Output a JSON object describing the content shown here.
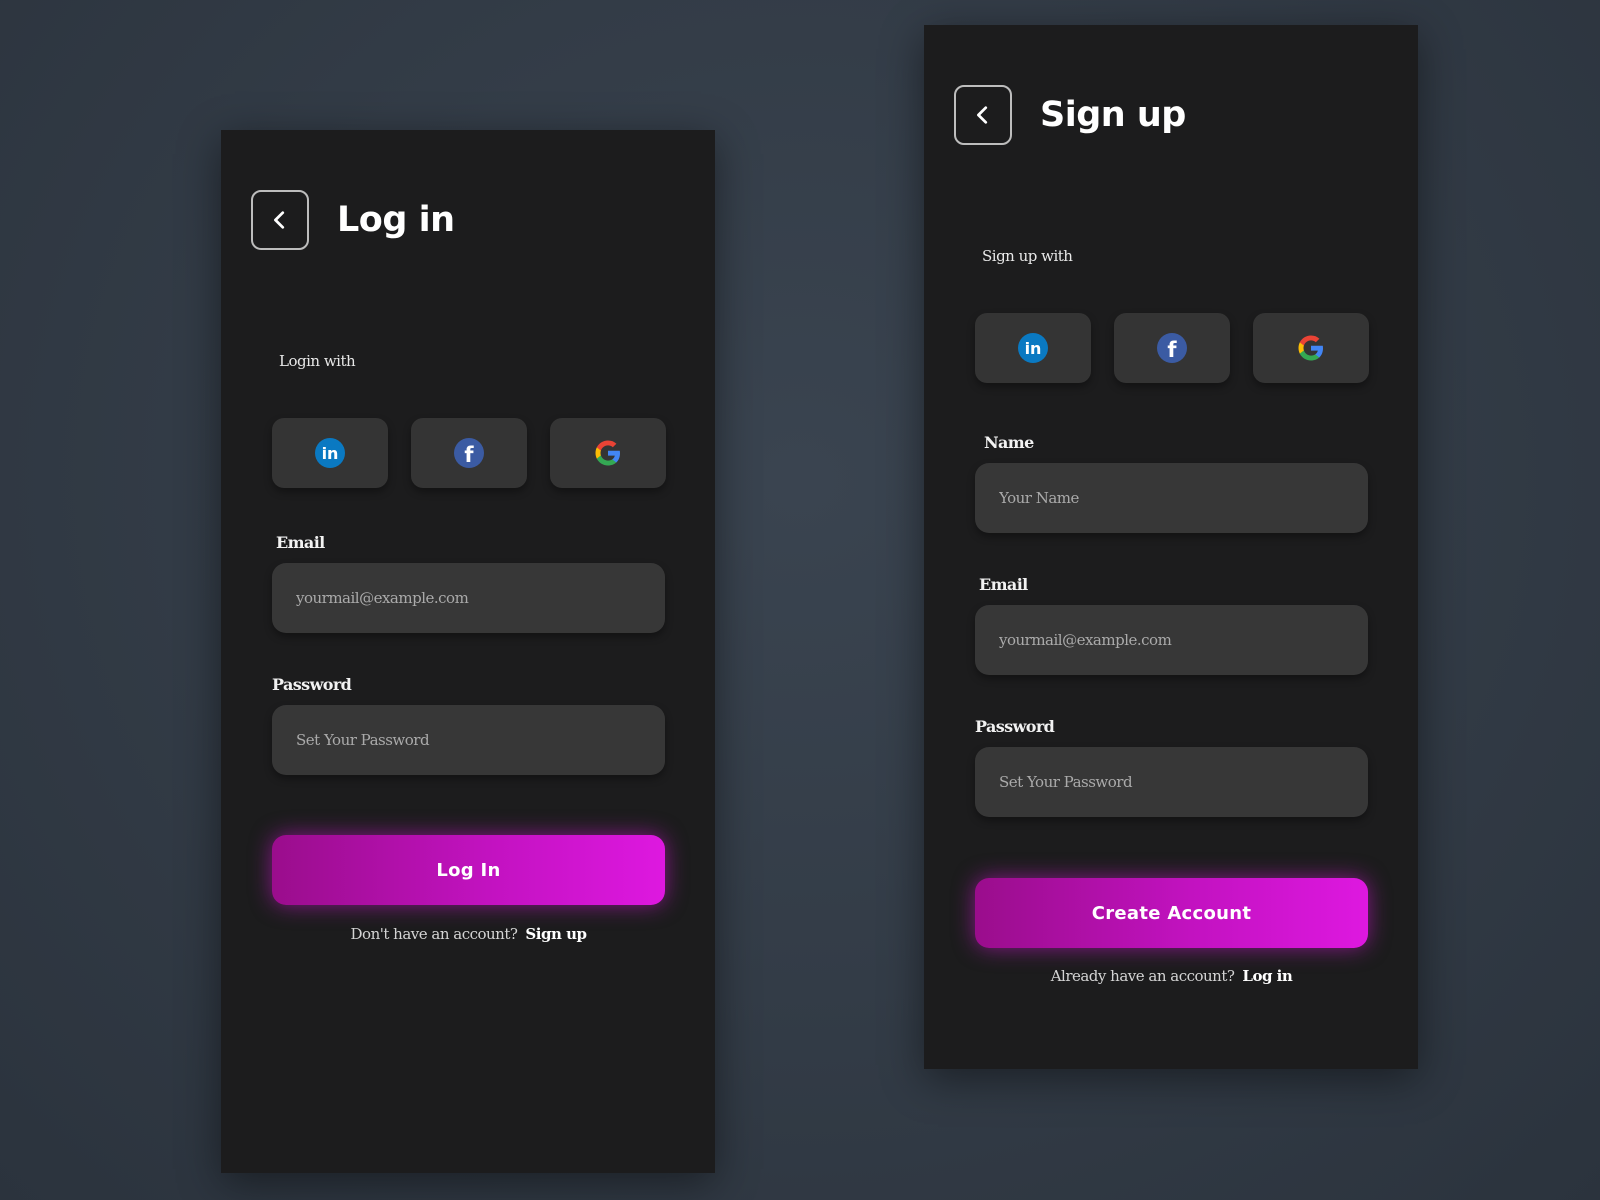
{
  "login": {
    "title": "Log in",
    "social_label": "Login with",
    "social": [
      {
        "name": "LinkedIn",
        "icon": "linkedin-icon"
      },
      {
        "name": "Facebook",
        "icon": "facebook-icon"
      },
      {
        "name": "Google",
        "icon": "google-icon"
      }
    ],
    "email_label": "Email",
    "email_placeholder": "yourmail@example.com",
    "password_label": "Password",
    "password_placeholder": "Set Your Password",
    "submit_label": "Log In",
    "footer_text": "Don't have an account?",
    "footer_link": "Sign up"
  },
  "signup": {
    "title": "Sign up",
    "social_label": "Sign up with",
    "social": [
      {
        "name": "LinkedIn",
        "icon": "linkedin-icon"
      },
      {
        "name": "Facebook",
        "icon": "facebook-icon"
      },
      {
        "name": "Google",
        "icon": "google-icon"
      }
    ],
    "name_label": "Name",
    "name_placeholder": "Your Name",
    "email_label": "Email",
    "email_placeholder": "yourmail@example.com",
    "password_label": "Password",
    "password_placeholder": "Set Your Password",
    "submit_label": "Create Account",
    "footer_text": "Already have an account?",
    "footer_link": "Log in"
  },
  "colors": {
    "accent_start": "#9a0d8c",
    "accent_end": "#de18e0",
    "panel_bg": "#1c1c1d",
    "field_bg": "#373737"
  }
}
